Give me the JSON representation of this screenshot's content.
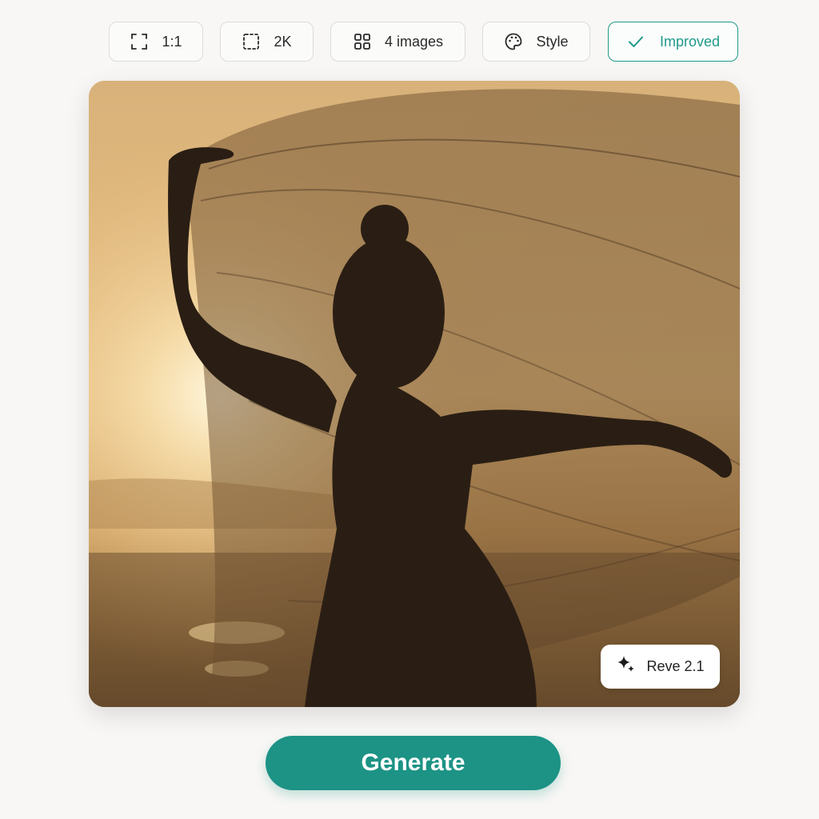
{
  "toolbar": {
    "aspect_ratio": {
      "label": "1:1",
      "icon": "aspect-ratio-icon"
    },
    "resolution": {
      "label": "2K",
      "icon": "resolution-icon"
    },
    "count": {
      "label": "4 images",
      "icon": "grid-icon"
    },
    "style": {
      "label": "Style",
      "icon": "palette-icon"
    },
    "improved": {
      "label": "Improved",
      "icon": "checkmark-icon",
      "active": true
    }
  },
  "preview": {
    "model_badge": {
      "label": "Reve 2.1",
      "icon": "sparkle-icon"
    }
  },
  "actions": {
    "generate_label": "Generate"
  },
  "colors": {
    "accent": "#1c9385",
    "background": "#f8f7f5"
  }
}
